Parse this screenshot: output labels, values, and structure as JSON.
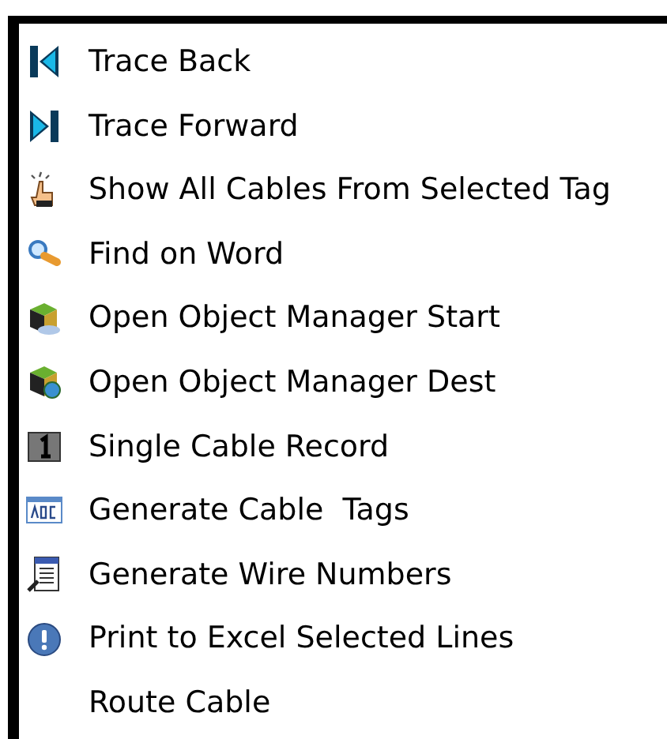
{
  "menu": {
    "items": [
      {
        "label": "Trace Back"
      },
      {
        "label": "Trace Forward"
      },
      {
        "label": "Show All Cables From Selected Tag"
      },
      {
        "label": "Find on Word"
      },
      {
        "label": "Open Object Manager Start"
      },
      {
        "label": "Open Object Manager Dest"
      },
      {
        "label": "Single Cable Record"
      },
      {
        "label": "Generate Cable  Tags"
      },
      {
        "label": "Generate Wire Numbers"
      },
      {
        "label": "Print to Excel Selected Lines"
      },
      {
        "label": "Route Cable"
      }
    ]
  }
}
